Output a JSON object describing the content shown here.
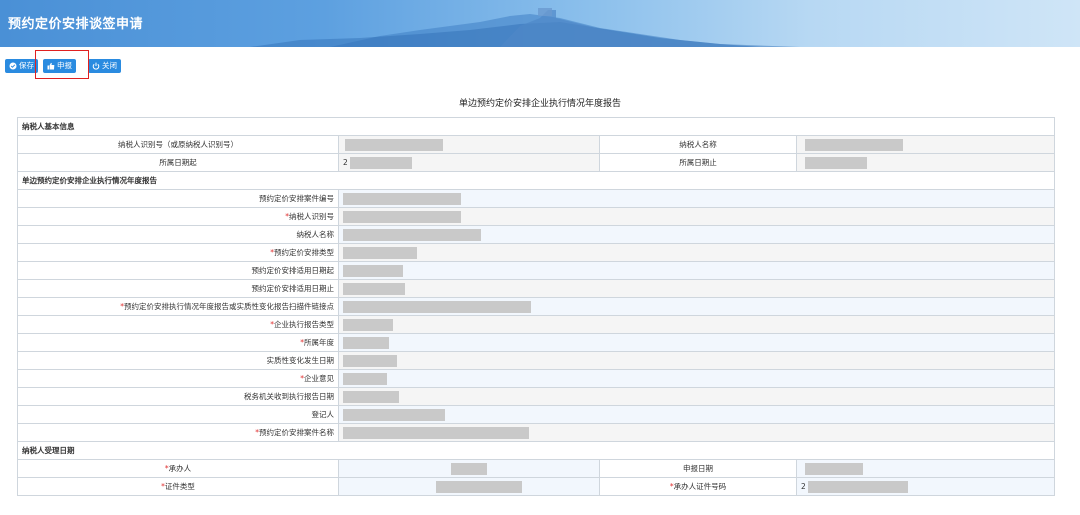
{
  "header": {
    "title": "预约定价安排谈签申请"
  },
  "toolbar": {
    "save_label": "保存",
    "submit_label": "申报",
    "close_label": "关闭"
  },
  "form": {
    "title": "单边预约定价安排企业执行情况年度报告",
    "section1": {
      "title": "纳税人基本信息",
      "taxpayer_id_label": "纳税人识别号（或原纳税人识别号）",
      "taxpayer_name_label": "纳税人名称",
      "period_start_label": "所属日期起",
      "period_start_prefix": "2",
      "period_end_label": "所属日期止"
    },
    "section2": {
      "title": "单边预约定价安排企业执行情况年度报告",
      "rows": [
        {
          "label": "预约定价安排案件编号",
          "required": false
        },
        {
          "label": "纳税人识别号",
          "required": true
        },
        {
          "label": "纳税人名称",
          "required": false
        },
        {
          "label": "预约定价安排类型",
          "required": true
        },
        {
          "label": "预约定价安排适用日期起",
          "required": false
        },
        {
          "label": "预约定价安排适用日期止",
          "required": false
        },
        {
          "label": "预约定价安排执行情况年度报告或实质性变化报告扫描件链接点",
          "required": true
        },
        {
          "label": "企业执行报告类型",
          "required": true
        },
        {
          "label": "所属年度",
          "required": true
        },
        {
          "label": "实质性变化发生日期",
          "required": false
        },
        {
          "label": "企业意见",
          "required": true
        },
        {
          "label": "税务机关收到执行报告日期",
          "required": false
        },
        {
          "label": "登记人",
          "required": false
        },
        {
          "label": "预约定价安排案件名称",
          "required": true
        }
      ]
    },
    "section3": {
      "title": "纳税人受理日期",
      "handler_label": "承办人",
      "declare_date_label": "申报日期",
      "cert_type_label": "证件类型",
      "handler_cert_label": "承办人证件号码",
      "handler_cert_prefix": "2",
      "required_mark": "*"
    }
  },
  "colors": {
    "accent": "#2a8be0",
    "header_start": "#4a90d6",
    "highlight": "#e02020",
    "required": "#e03030"
  }
}
